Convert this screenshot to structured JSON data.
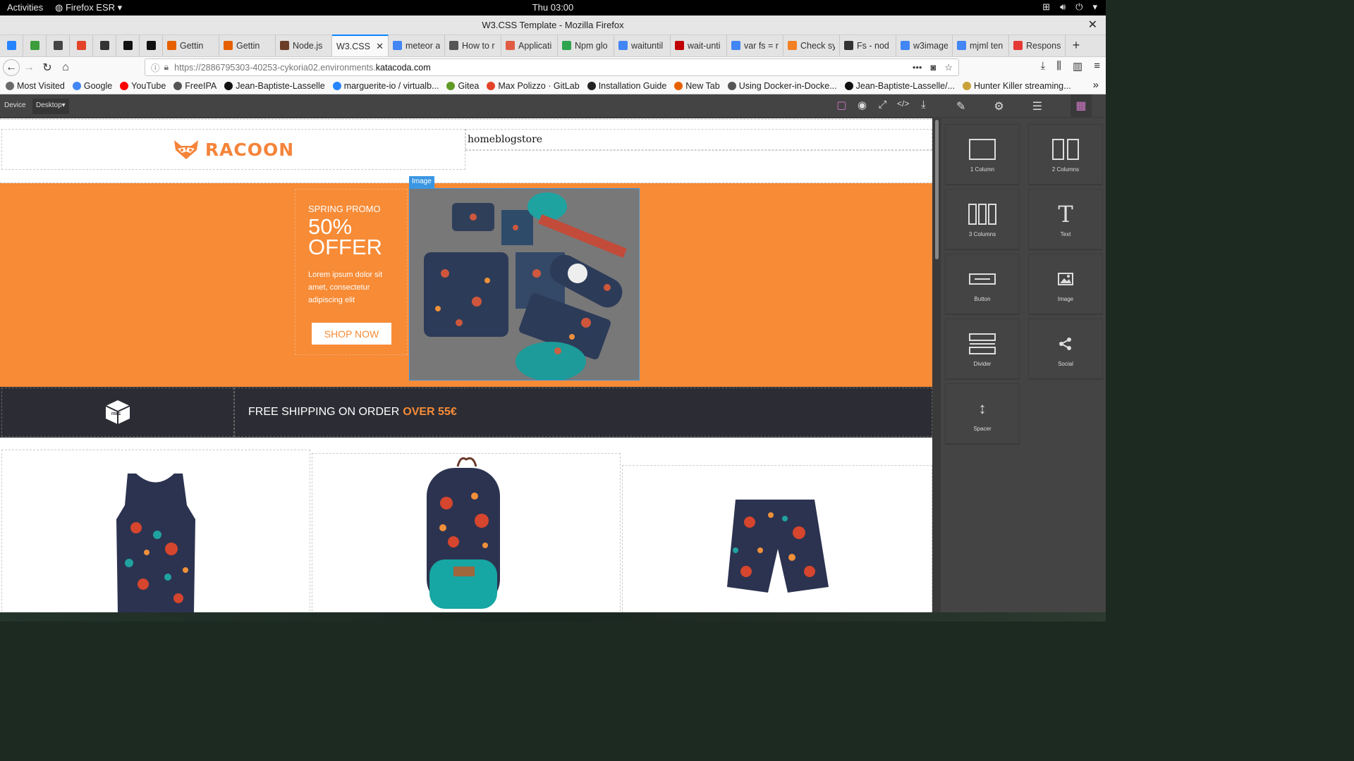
{
  "system": {
    "activities": "Activities",
    "app_menu": "Firefox ESR ▾",
    "clock": "Thu 03:00"
  },
  "window": {
    "title": "W3.CSS Template - Mozilla Firefox",
    "close": "✕"
  },
  "tabs": [
    {
      "label": "Gettin",
      "color": "#e66000"
    },
    {
      "label": "Gettin",
      "color": "#e66000"
    },
    {
      "label": "Node.js",
      "color": "#6b3e26"
    },
    {
      "label": "W3.CSS",
      "active": true
    },
    {
      "label": "meteor a",
      "color": "#4285f4"
    },
    {
      "label": "How to r",
      "color": "#555555"
    },
    {
      "label": "Applicati",
      "color": "#e05d44"
    },
    {
      "label": "Npm glo",
      "color": "#2ea44f"
    },
    {
      "label": "waituntil",
      "color": "#4285f4"
    },
    {
      "label": "wait-unti",
      "color": "#c00000"
    },
    {
      "label": "var fs = r",
      "color": "#4285f4"
    },
    {
      "label": "Check sy",
      "color": "#f48024"
    },
    {
      "label": "Fs - nod",
      "color": "#333333"
    },
    {
      "label": "w3image",
      "color": "#4285f4"
    },
    {
      "label": "mjml ten",
      "color": "#4285f4"
    },
    {
      "label": "Respons",
      "color": "#e53935"
    }
  ],
  "pinned_tabs": [
    {
      "icon": "bitbucket-icon",
      "color": "#2684ff"
    },
    {
      "icon": "extension-icon",
      "color": "#3c9d3c"
    },
    {
      "icon": "notes-icon",
      "color": "#444444"
    },
    {
      "icon": "gitlab-icon",
      "color": "#e24329"
    },
    {
      "icon": "globe-icon",
      "color": "#333333"
    },
    {
      "icon": "github-icon",
      "color": "#111111"
    },
    {
      "icon": "github-icon",
      "color": "#111111"
    }
  ],
  "url": {
    "prefix": "https://2886795303-40253-cykoria02.environments.",
    "domain": "katacoda.com"
  },
  "bookmarks": [
    {
      "label": "Most Visited",
      "color": "#6a6a6a"
    },
    {
      "label": "Google",
      "color": "#4285f4"
    },
    {
      "label": "YouTube",
      "color": "#ff0000"
    },
    {
      "label": "FreeIPA",
      "color": "#555555"
    },
    {
      "label": "Jean-Baptiste-Lasselle",
      "color": "#111111"
    },
    {
      "label": "marguerite-io / virtualb...",
      "color": "#2684ff"
    },
    {
      "label": "Gitea",
      "color": "#609926"
    },
    {
      "label": "Max Polizzo · GitLab",
      "color": "#e24329"
    },
    {
      "label": "Installation Guide",
      "color": "#222222"
    },
    {
      "label": "New Tab",
      "color": "#e66000"
    },
    {
      "label": "Using Docker-in-Docke...",
      "color": "#555555"
    },
    {
      "label": "Jean-Baptiste-Lasselle/...",
      "color": "#111111"
    },
    {
      "label": "Hunter Killer streaming...",
      "color": "#c9a23a"
    }
  ],
  "editor": {
    "device_label": "Device",
    "device_value": "Desktop▾",
    "blocks": [
      {
        "label": "1 Column",
        "icon": "one-column-icon"
      },
      {
        "label": "2 Columns",
        "icon": "two-columns-icon"
      },
      {
        "label": "3 Columns",
        "icon": "three-columns-icon"
      },
      {
        "label": "Text",
        "icon": "text-icon"
      },
      {
        "label": "Button",
        "icon": "button-block-icon"
      },
      {
        "label": "Image",
        "icon": "image-block-icon"
      },
      {
        "label": "Divider",
        "icon": "divider-icon"
      },
      {
        "label": "Social",
        "icon": "share-icon"
      },
      {
        "label": "Spacer",
        "icon": "spacer-icon"
      }
    ]
  },
  "page": {
    "logo": "RACOON",
    "nav": "homeblogstore",
    "hero": {
      "promo_title": "SPRING PROMO",
      "offer_line1": "50%",
      "offer_line2": "OFFER",
      "desc": "Lorem ipsum dolor sit amet, consectetur adipiscing elit",
      "button": "SHOP NOW",
      "image_tag": "Image"
    },
    "shipping": {
      "text": "FREE SHIPPING ON ORDER",
      "highlight": "OVER 55€",
      "icon_label": "FREE"
    }
  },
  "colors": {
    "brand_orange": "#f78b36",
    "dark_bar": "#2c2d34",
    "accent_blue": "#3b97e3",
    "panel": "#444444"
  }
}
